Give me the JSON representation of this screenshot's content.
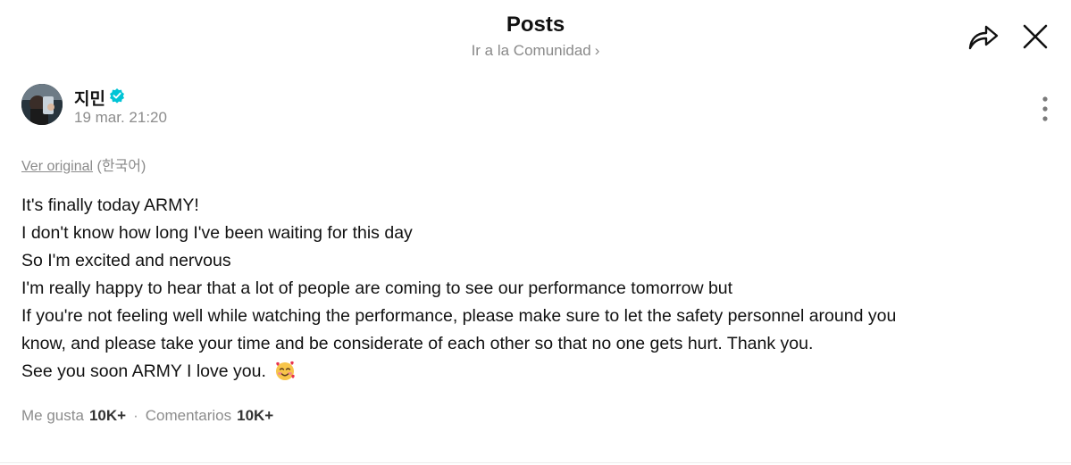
{
  "header": {
    "title": "Posts",
    "community_link": "Ir a la Comunidad",
    "share_icon": "share-arrow-icon",
    "close_icon": "close-icon"
  },
  "post": {
    "author": "지민",
    "verified_color": "#00c4d6",
    "date": "19 mar. 21:20",
    "translation_link": "Ver original",
    "translation_lang": "(한국어)",
    "lines": [
      "It's finally today ARMY!",
      "I don't know how long I've been waiting for this day",
      "So I'm excited and nervous",
      "I'm really happy to hear that a lot of people are coming to see our performance tomorrow but",
      "If you're not feeling well while watching the performance, please make sure to let the safety personnel around you",
      "know, and please take your time and be considerate of each other so that no one gets hurt. Thank you.",
      "See you soon ARMY I love you."
    ],
    "emoji": "smiling-face-with-hearts-icon"
  },
  "stats": {
    "likes_label": "Me gusta",
    "likes_count": "10K+",
    "separator": "·",
    "comments_label": "Comentarios",
    "comments_count": "10K+"
  }
}
